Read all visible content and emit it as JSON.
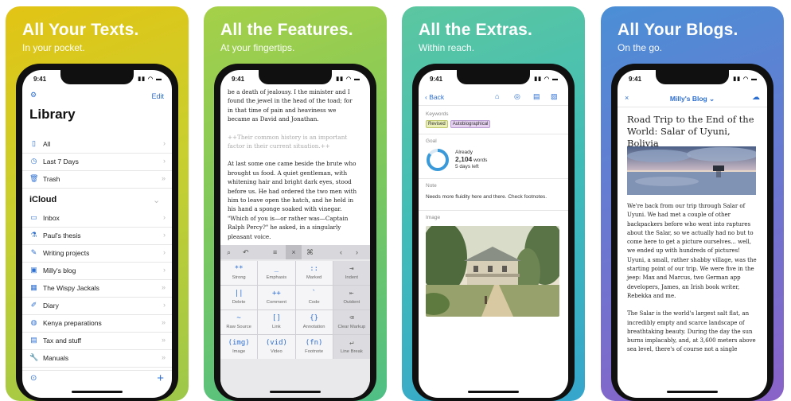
{
  "panels": [
    {
      "title": "All Your Texts.",
      "subtitle": "In your pocket."
    },
    {
      "title": "All the Features.",
      "subtitle": "At your fingertips."
    },
    {
      "title": "All the Extras.",
      "subtitle": "Within reach."
    },
    {
      "title": "All Your Blogs.",
      "subtitle": "On the go."
    }
  ],
  "status_time": "9:41",
  "library": {
    "edit": "Edit",
    "title": "Library",
    "items_top": [
      {
        "label": "All",
        "icon": "doc-icon"
      },
      {
        "label": "Last 7 Days",
        "icon": "clock-icon"
      },
      {
        "label": "Trash",
        "icon": "trash-icon"
      }
    ],
    "section": "iCloud",
    "items_cloud": [
      {
        "label": "Inbox",
        "icon": "inbox-icon"
      },
      {
        "label": "Paul's thesis",
        "icon": "flask-icon"
      },
      {
        "label": "Writing projects",
        "icon": "compass-icon"
      },
      {
        "label": "Milly's blog",
        "icon": "blog-icon"
      },
      {
        "label": "The Wispy Jackals",
        "icon": "grid-icon"
      },
      {
        "label": "Diary",
        "icon": "pen-icon"
      },
      {
        "label": "Kenya preparations",
        "icon": "globe-icon"
      },
      {
        "label": "Tax and stuff",
        "icon": "calculator-icon"
      },
      {
        "label": "Manuals",
        "icon": "wrench-icon"
      }
    ]
  },
  "editor": {
    "paragraphs": [
      "be a death of jealousy. I the minister and I found the jewel in the head of the toad; for in that time of pain and heaviness we became as David and Jonathan.",
      "++Their common history is an important factor in their current situation.++",
      "At last some one came beside the brute who brought us food. A quiet gentleman, with whitening hair and bright dark eyes, stood before us. He had ordered the two men with him to leave open the hatch, and he held in his hand a sponge soaked with vinegar. \"Which of you is—or rather was—Captain Ralph Percy?\" he asked, in a singularly pleasant voice."
    ],
    "toolbar": [
      "search-icon",
      "undo-icon",
      "list-icon",
      "close-icon",
      "command-icon",
      "left-icon",
      "right-icon"
    ],
    "keys": [
      {
        "sym": "**",
        "label": "Strong"
      },
      {
        "sym": "_",
        "label": "Emphasis"
      },
      {
        "sym": "::",
        "label": "Marked"
      },
      {
        "sym": "⇥",
        "label": "Indent"
      },
      {
        "sym": "||",
        "label": "Delete"
      },
      {
        "sym": "++",
        "label": "Comment"
      },
      {
        "sym": "`",
        "label": "Code"
      },
      {
        "sym": "⇤",
        "label": "Outdent"
      },
      {
        "sym": "~",
        "label": "Raw Source"
      },
      {
        "sym": "[]",
        "label": "Link"
      },
      {
        "sym": "{}",
        "label": "Annotation"
      },
      {
        "sym": "⌫",
        "label": "Clear Markup"
      },
      {
        "sym": "(img)",
        "label": "Image"
      },
      {
        "sym": "(vid)",
        "label": "Video"
      },
      {
        "sym": "(fn)",
        "label": "Footnote"
      },
      {
        "sym": "↵",
        "label": "Line Break"
      }
    ]
  },
  "extras": {
    "back": "Back",
    "keywords_label": "Keywords",
    "tags": [
      "Revised",
      "Autobiographical"
    ],
    "goal_label": "Goal",
    "goal_already": "Already",
    "goal_words": "2,104",
    "goal_words_unit": "words",
    "goal_days": "5 days left",
    "goal_progress": 0.85,
    "note_label": "Note",
    "note_text": "Needs more fluidity here and there. Check footnotes.",
    "image_label": "Image"
  },
  "blog": {
    "close": "×",
    "blog_name": "Milly's Blog ⌄",
    "title": "Road Trip to the End of the World: Salar of Uyuni, Bolivia",
    "paragraphs": [
      "We're back from our trip through Salar of Uyuni. We had met a couple of other backpackers before who went into raptures about the Salar, so we actually had no but to come here to get a picture ourselves... well, we ended up with hundreds of pictures! Uyuni, a small, rather shabby village, was the starting point of our trip. We were five in the jeep: Max and Marcus, two German app developers, James, an Irish book writer, Rebekka and me.",
      "The Salar is the world's largest salt flat, an incredibly empty and scarce landscape of breathtaking beauty. During the day the sun burns implacably, and, at 3,600 meters above sea level, there's of course not a single"
    ]
  }
}
